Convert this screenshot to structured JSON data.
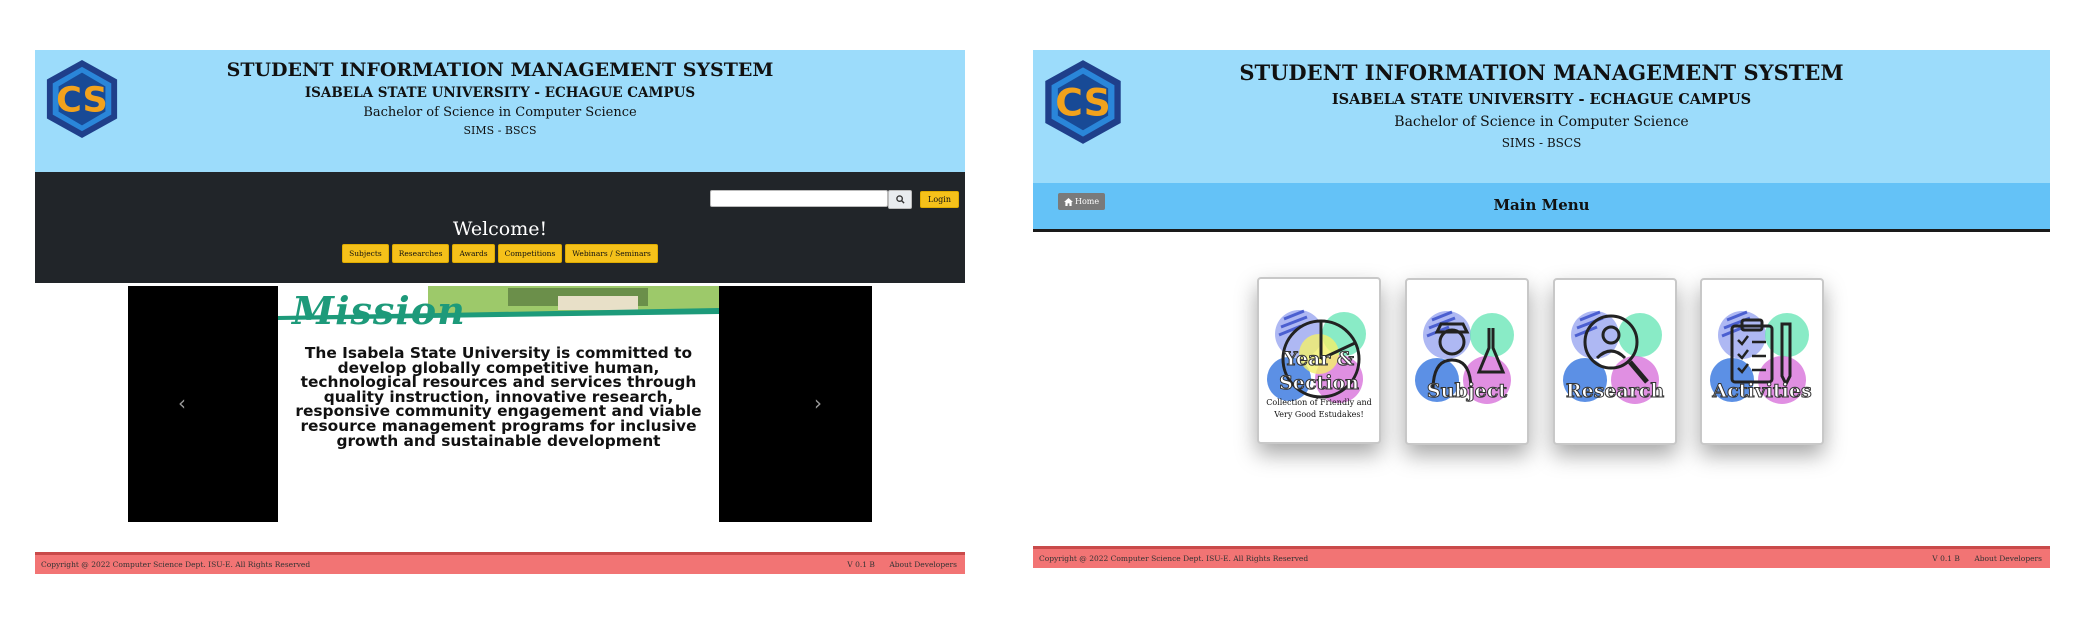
{
  "colors": {
    "header_bg": "#9cdcfb",
    "menubar_bg": "#64c2f7",
    "dark_bg": "#212529",
    "accent_button": "#f5c11a",
    "footer_bg": "#f27474",
    "mission_green": "#1d9a7a"
  },
  "left": {
    "header": {
      "title": "STUDENT INFORMATION MANAGEMENT SYSTEM",
      "university": "ISABELA STATE UNIVERSITY - ECHAGUE CAMPUS",
      "program": "Bachelor of Science in Computer Science",
      "abbr": "SIMS - BSCS",
      "logo_text": "CS"
    },
    "search": {
      "placeholder": "",
      "icon": "search-icon"
    },
    "login_label": "Login",
    "welcome": "Welcome!",
    "nav": [
      "Subjects",
      "Researches",
      "Awards",
      "Competitions",
      "Webinars / Seminars"
    ],
    "carousel": {
      "heading": "Mission",
      "text": "The Isabela State University is committed to develop globally competitive human, technological resources and services through quality instruction, innovative research, responsive community engagement and viable resource management programs for inclusive growth and sustainable development",
      "prev": "‹",
      "next": "›"
    },
    "footer": {
      "copyright": "Copyright @ 2022 Computer Science Dept. ISU-E. All Rights Reserved",
      "version": "V 0.1 B",
      "about": "About Developers"
    }
  },
  "right": {
    "header": {
      "title": "STUDENT INFORMATION MANAGEMENT SYSTEM",
      "university": "ISABELA STATE UNIVERSITY - ECHAGUE CAMPUS",
      "program": "Bachelor of Science in Computer Science",
      "abbr": "SIMS - BSCS",
      "logo_text": "CS"
    },
    "home_label": "Home",
    "menu_title": "Main Menu",
    "cards": [
      {
        "label_line1": "Year &",
        "label_line2": "Section",
        "subtext": "Collection of Friendly and Very Good Estudakes!",
        "icon": "pie-chart-icon"
      },
      {
        "label": "Subject",
        "icon": "scientist-icon"
      },
      {
        "label": "Research",
        "icon": "magnifier-person-icon"
      },
      {
        "label": "Activities",
        "icon": "clipboard-checklist-icon"
      }
    ],
    "footer": {
      "copyright": "Copyright @ 2022 Computer Science Dept. ISU-E. All Rights Reserved",
      "version": "V 0.1 B",
      "about": "About Developers"
    }
  }
}
